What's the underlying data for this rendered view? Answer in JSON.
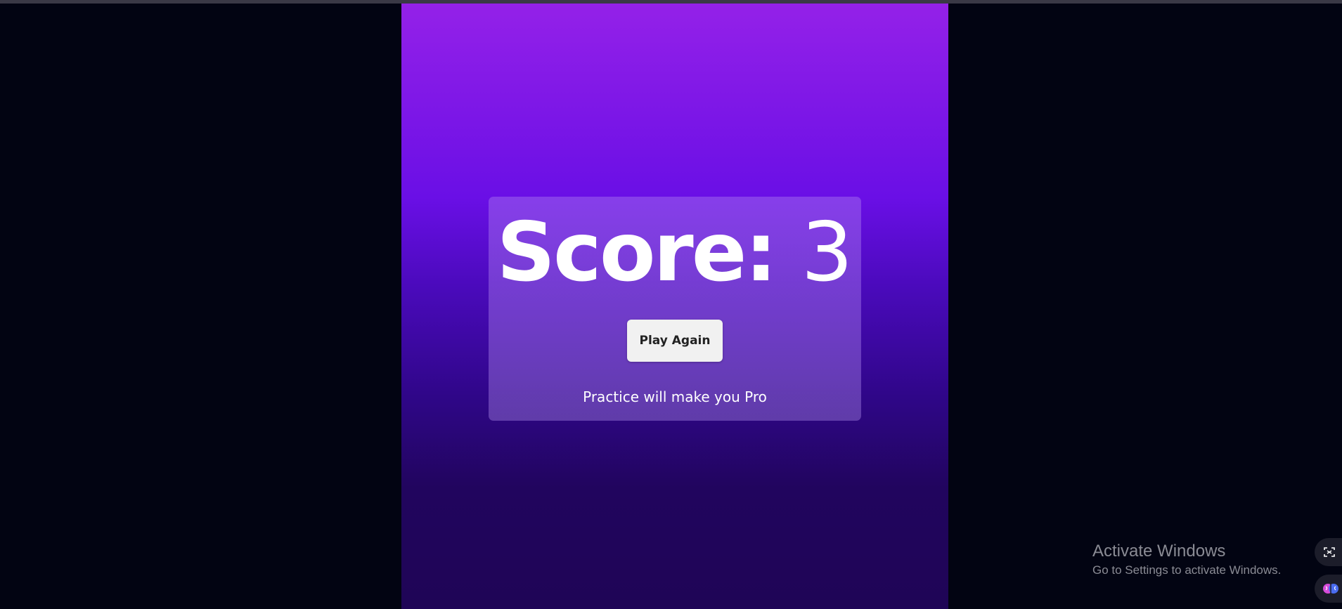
{
  "score": {
    "label": "Score:",
    "value": "3"
  },
  "actions": {
    "play_again_label": "Play Again"
  },
  "message": "Practice will make you Pro",
  "os_watermark": {
    "title": "Activate Windows",
    "subtitle": "Go to Settings to activate Windows."
  },
  "side_widgets": [
    {
      "icon": "screen-capture-icon"
    },
    {
      "icon": "brain-extension-icon"
    }
  ],
  "colors": {
    "background": "#020412",
    "panel_top": "#9421e8",
    "panel_bottom": "#1f0556",
    "button_bg": "#f1f1f1",
    "text": "#ffffff"
  }
}
